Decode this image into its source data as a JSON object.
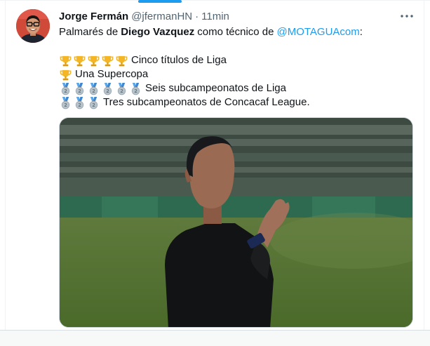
{
  "tweet": {
    "author_name": "Jorge Fermán",
    "handle": "@jfermanHN",
    "separator": "·",
    "time": "11min",
    "more_label": "···",
    "text": {
      "intro_before": "Palmarés de ",
      "intro_name": "Diego Vazquez",
      "intro_middle": " como técnico de ",
      "intro_mention": "@MOTAGUAcom",
      "intro_after": " :",
      "line1": "Cinco títulos de Liga",
      "line2": "Una Supercopa",
      "line3": "Seis subcampeonatos de Liga",
      "line4": "Tres subcampeonatos de Concacaf League."
    },
    "emoji": {
      "line1": {
        "icon": "trophy-icon",
        "count": 5
      },
      "line2": {
        "icon": "trophy-icon",
        "count": 1
      },
      "line3": {
        "icon": "second-place-medal-icon",
        "count": 6
      },
      "line4": {
        "icon": "second-place-medal-icon",
        "count": 3
      }
    }
  },
  "colors": {
    "accent": "#1d9bf0",
    "text_primary": "#0f1419",
    "text_secondary": "#536471",
    "border": "#eff3f4",
    "trophy_gold": "#f5b625",
    "medal_silver": "#b8c4cc",
    "medal_ribbon": "#5aa6e8"
  }
}
